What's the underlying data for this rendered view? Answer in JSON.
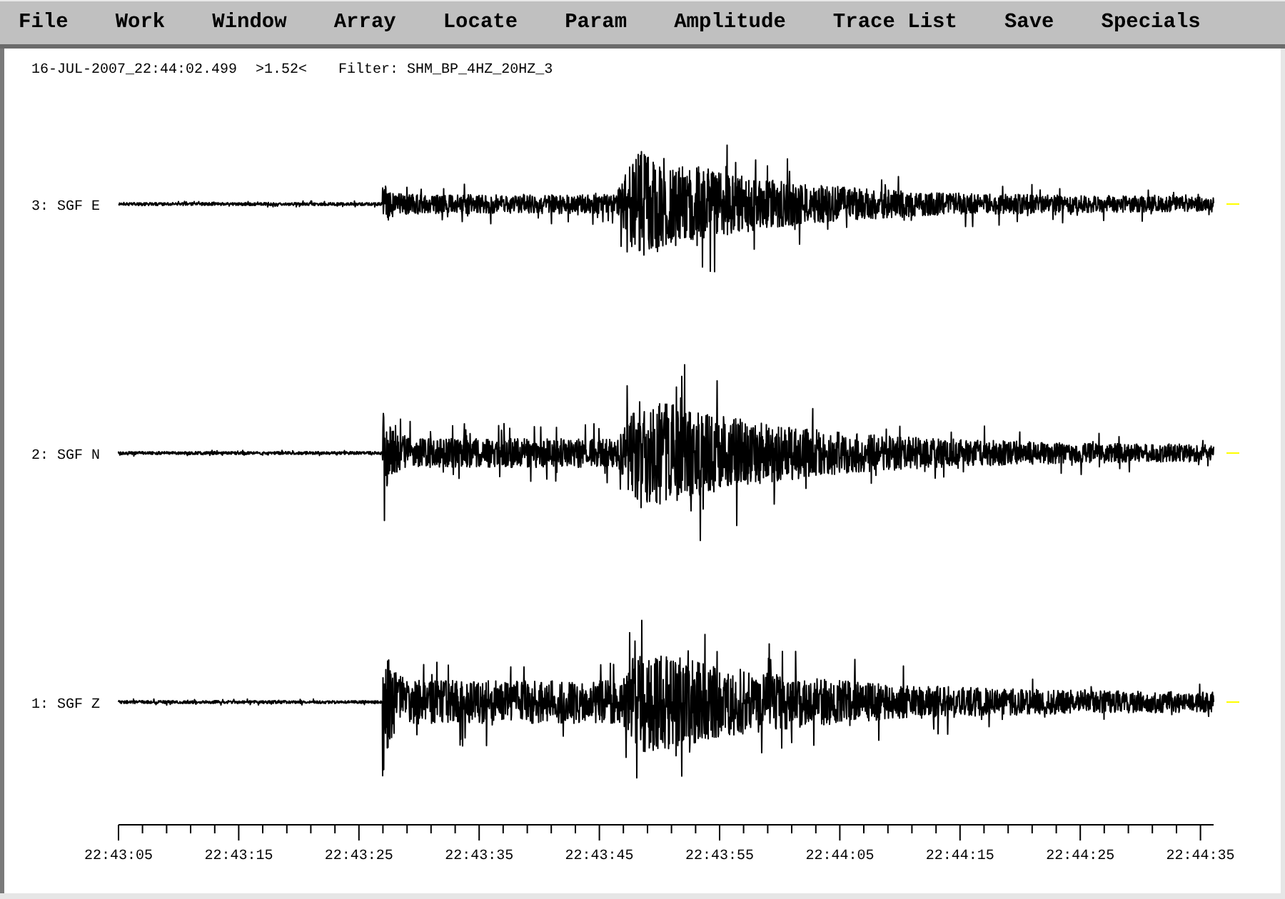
{
  "menu_items": [
    "File",
    "Work",
    "Window",
    "Array",
    "Locate",
    "Param",
    "Amplitude",
    "Trace List",
    "Save",
    "Specials"
  ],
  "header": {
    "timestamp": "16-JUL-2007_22:44:02.499",
    "value": ">1.52<",
    "filter": "Filter: SHM_BP_4HZ_20HZ_3"
  },
  "traces": [
    {
      "label": "3: SGF E"
    },
    {
      "label": "2: SGF N"
    },
    {
      "label": "1: SGF Z"
    }
  ],
  "time_axis": {
    "tick_labels": [
      "22:43:05",
      "22:43:15",
      "22:43:25",
      "22:43:35",
      "22:43:45",
      "22:43:55",
      "22:44:05",
      "22:44:15",
      "22:44:25",
      "22:44:35"
    ]
  }
}
